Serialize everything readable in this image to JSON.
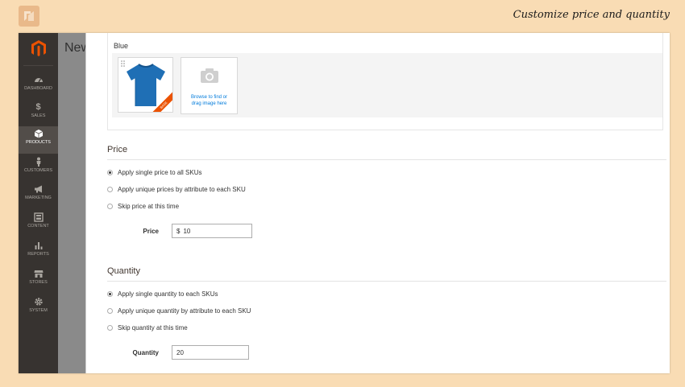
{
  "banner": {
    "title": "Customize price and quantity"
  },
  "sidebar": {
    "items": [
      {
        "label": "DASHBOARD",
        "icon": "dashboard-icon",
        "active": false
      },
      {
        "label": "SALES",
        "icon": "dollar-icon",
        "active": false
      },
      {
        "label": "PRODUCTS",
        "icon": "cube-icon",
        "active": true
      },
      {
        "label": "CUSTOMERS",
        "icon": "person-icon",
        "active": false
      },
      {
        "label": "MARKETING",
        "icon": "megaphone-icon",
        "active": false
      },
      {
        "label": "CONTENT",
        "icon": "layout-icon",
        "active": false
      },
      {
        "label": "REPORTS",
        "icon": "bar-chart-icon",
        "active": false
      },
      {
        "label": "STORES",
        "icon": "store-icon",
        "active": false
      },
      {
        "label": "SYSTEM",
        "icon": "gear-icon",
        "active": false
      }
    ]
  },
  "background_page": {
    "title": "New"
  },
  "images": {
    "color_label": "Blue",
    "upload_text_line1": "Browse to find or",
    "upload_text_line2": "drag image here",
    "ribbon_text": "BASE"
  },
  "price": {
    "title": "Price",
    "options": [
      {
        "label": "Apply single price to all SKUs",
        "checked": true
      },
      {
        "label": "Apply unique prices by attribute to each SKU",
        "checked": false
      },
      {
        "label": "Skip price at this time",
        "checked": false
      }
    ],
    "field_label": "Price",
    "currency": "$",
    "value": "10"
  },
  "quantity": {
    "title": "Quantity",
    "options": [
      {
        "label": "Apply single quantity to each SKUs",
        "checked": true
      },
      {
        "label": "Apply unique quantity by attribute to each SKU",
        "checked": false
      },
      {
        "label": "Skip quantity at this time",
        "checked": false
      }
    ],
    "field_label": "Quantity",
    "value": "20"
  },
  "colors": {
    "page_background": "#f9dcb4",
    "sidebar": "#373330",
    "sidebar_active": "#524d49",
    "accent_orange": "#eb5202",
    "link_blue": "#007bdb",
    "tshirt_blue": "#1f6fb5"
  }
}
